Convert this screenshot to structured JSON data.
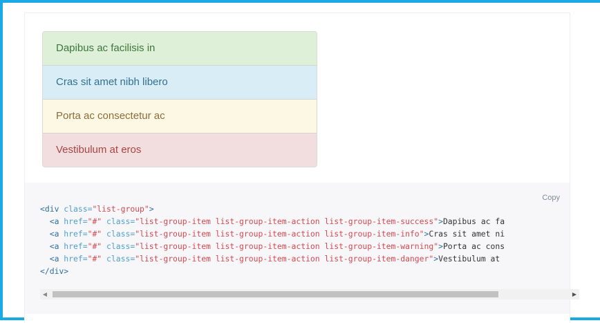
{
  "list_group": {
    "items": [
      {
        "label": "Dapibus ac facilisis in",
        "variant": "success"
      },
      {
        "label": "Cras sit amet nibh libero",
        "variant": "info"
      },
      {
        "label": "Porta ac consectetur ac",
        "variant": "warning"
      },
      {
        "label": "Vestibulum at eros",
        "variant": "danger"
      }
    ]
  },
  "code_block": {
    "copy_label": "Copy",
    "lines": [
      {
        "open": "<div",
        "a1": " class=",
        "s1": "\"list-group\"",
        "close": ">",
        "text": ""
      },
      {
        "open": "  <a",
        "a1": " href=",
        "s1": "\"#\"",
        "a2": " class=",
        "s2": "\"list-group-item list-group-item-action list-group-item-success\"",
        "close": ">",
        "text": "Dapibus ac fa"
      },
      {
        "open": "  <a",
        "a1": " href=",
        "s1": "\"#\"",
        "a2": " class=",
        "s2": "\"list-group-item list-group-item-action list-group-item-info\"",
        "close": ">",
        "text": "Cras sit amet ni"
      },
      {
        "open": "  <a",
        "a1": " href=",
        "s1": "\"#\"",
        "a2": " class=",
        "s2": "\"list-group-item list-group-item-action list-group-item-warning\"",
        "close": ">",
        "text": "Porta ac cons"
      },
      {
        "open": "  <a",
        "a1": " href=",
        "s1": "\"#\"",
        "a2": " class=",
        "s2": "\"list-group-item list-group-item-action list-group-item-danger\"",
        "close": ">",
        "text": "Vestibulum at"
      },
      {
        "open": "</div",
        "close": ">",
        "text": ""
      }
    ],
    "scrollbar": {
      "left_arrow": "◀",
      "right_arrow": "▶"
    }
  },
  "colors": {
    "frame_border": "#19a9e6",
    "success_bg": "#dff0d8",
    "info_bg": "#d9edf7",
    "warning_bg": "#fcf8e3",
    "danger_bg": "#f2dede",
    "code_bg": "#f7f7f9"
  }
}
